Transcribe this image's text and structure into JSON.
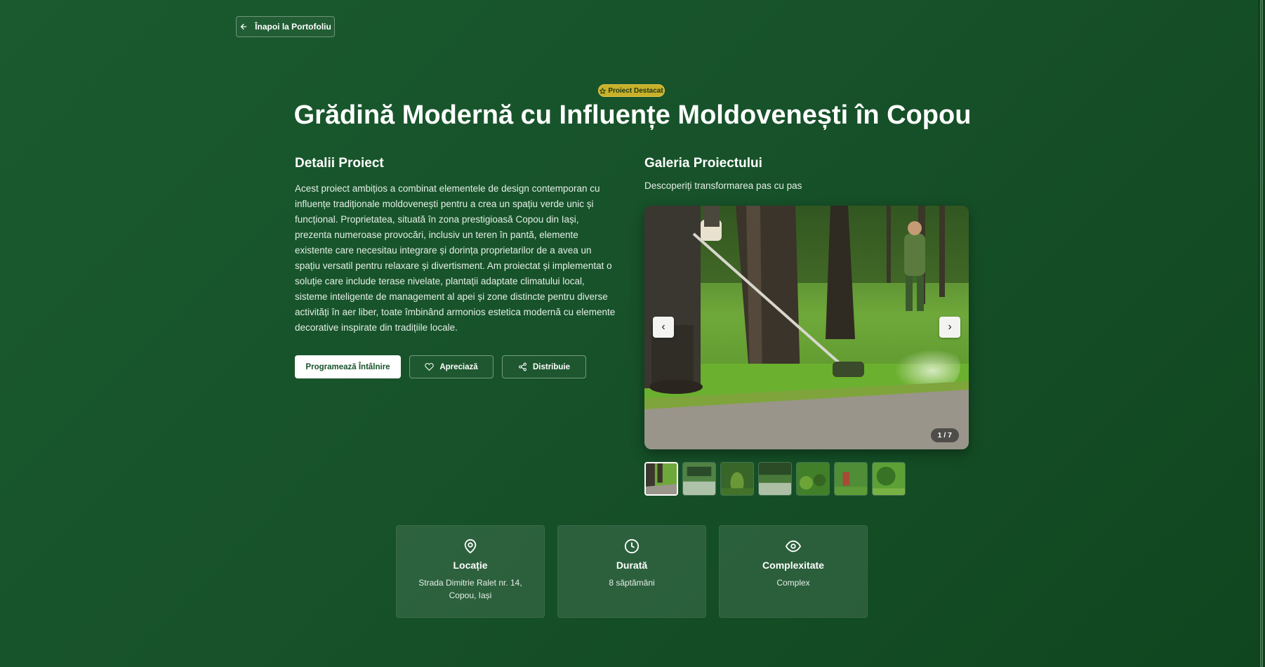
{
  "back_button": {
    "label": "Înapoi la Portofoliu",
    "icon": "arrow-left-icon"
  },
  "badge": {
    "label": "Proiect Destacat",
    "icon": "star-icon",
    "color": "#c9b02a"
  },
  "title": "Grădină Modernă cu Influențe Moldovenești în Copou",
  "details": {
    "heading": "Detalii Proiect",
    "description": "Acest proiect ambițios a combinat elementele de design contemporan cu influențe tradiționale moldovenești pentru a crea un spațiu verde unic și funcțional. Proprietatea, situată în zona prestigioasă Copou din Iași, prezenta numeroase provocări, inclusiv un teren în pantă, elemente existente care necesitau integrare și dorința proprietarilor de a avea un spațiu versatil pentru relaxare și divertisment. Am proiectat și implementat o soluție care include terase nivelate, plantații adaptate climatului local, sisteme inteligente de management al apei și zone distincte pentru diverse activități în aer liber, toate îmbinând armonios estetica modernă cu elemente decorative inspirate din tradițiile locale."
  },
  "actions": {
    "schedule": "Programează Întâlnire",
    "like": "Apreciază",
    "share": "Distribuie"
  },
  "gallery": {
    "heading": "Galeria Proiectului",
    "subtitle": "Descoperiți transformarea pas cu pas",
    "counter": "1 / 7",
    "prev_label": "‹",
    "next_label": "›",
    "thumbnail_count": 7
  },
  "info_cards": [
    {
      "icon": "map-pin-icon",
      "title": "Locație",
      "value": "Strada Dimitrie Ralet nr. 14, Copou, Iași"
    },
    {
      "icon": "clock-icon",
      "title": "Durată",
      "value": "8 săptămâni"
    },
    {
      "icon": "eye-icon",
      "title": "Complexitate",
      "value": "Complex"
    }
  ],
  "colors": {
    "background": "#17522a",
    "accent": "#ffffff",
    "badge": "#c9b02a"
  }
}
